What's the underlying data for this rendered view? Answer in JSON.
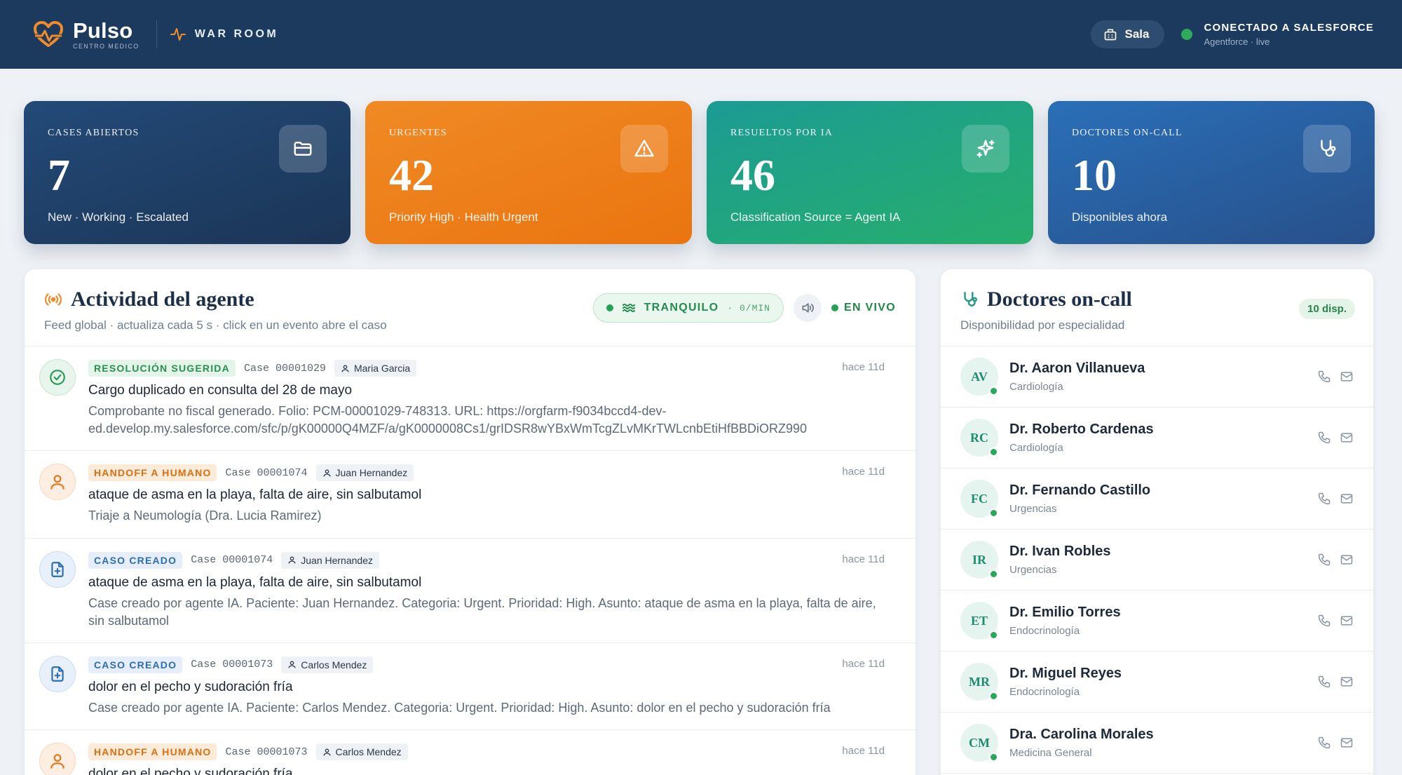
{
  "header": {
    "brand_name": "Pulso",
    "brand_sub": "CENTRO MEDICO",
    "section": "WAR ROOM",
    "sala_label": "Sala",
    "connection_title": "CONECTADO A SALESFORCE",
    "connection_sub": "Agentforce · live"
  },
  "kpis": [
    {
      "label": "CASES ABIERTOS",
      "value": "7",
      "sub": "New · Working · Escalated",
      "icon": "folder-icon"
    },
    {
      "label": "URGENTES",
      "value": "42",
      "sub": "Priority High · Health Urgent",
      "icon": "warning-icon"
    },
    {
      "label": "RESUELTOS POR IA",
      "value": "46",
      "sub": "Classification Source = Agent IA",
      "icon": "sparkles-icon"
    },
    {
      "label": "DOCTORES ON-CALL",
      "value": "10",
      "sub": "Disponibles ahora",
      "icon": "stethoscope-icon"
    }
  ],
  "activity": {
    "title": "Actividad del agente",
    "subtitle": "Feed global · actualiza cada 5 s · click en un evento abre el caso",
    "status_label": "TRANQUILO",
    "rate": "· 0/MIN",
    "live_label": "EN VIVO",
    "items": [
      {
        "tag": "RESOLUCIÓN SUGERIDA",
        "case": "Case 00001029",
        "person": "Maria Garcia",
        "time": "hace 11d",
        "title": "Cargo duplicado en consulta del 28 de mayo",
        "desc": "Comprobante no fiscal generado. Folio: PCM-00001029-748313. URL: https://orgfarm-f9034bccd4-dev-ed.develop.my.salesforce.com/sfc/p/gK00000Q4MZF/a/gK0000008Cs1/grIDSR8wYBxWmTcgZLvMKrTWLcnbEtiHfBBDiORZ990"
      },
      {
        "tag": "HANDOFF A HUMANO",
        "case": "Case 00001074",
        "person": "Juan Hernandez",
        "time": "hace 11d",
        "title": "ataque de asma en la playa, falta de aire, sin salbutamol",
        "desc": "Triaje a Neumología (Dra. Lucia Ramirez)"
      },
      {
        "tag": "CASO CREADO",
        "case": "Case 00001074",
        "person": "Juan Hernandez",
        "time": "hace 11d",
        "title": "ataque de asma en la playa, falta de aire, sin salbutamol",
        "desc": "Case creado por agente IA. Paciente: Juan Hernandez. Categoria: Urgent. Prioridad: High. Asunto: ataque de asma en la playa, falta de aire, sin salbutamol"
      },
      {
        "tag": "CASO CREADO",
        "case": "Case 00001073",
        "person": "Carlos Mendez",
        "time": "hace 11d",
        "title": "dolor en el pecho y sudoración fría",
        "desc": "Case creado por agente IA. Paciente: Carlos Mendez. Categoria: Urgent. Prioridad: High. Asunto: dolor en el pecho y sudoración fría"
      },
      {
        "tag": "HANDOFF A HUMANO",
        "case": "Case 00001073",
        "person": "Carlos Mendez",
        "time": "hace 11d",
        "title": "dolor en el pecho y sudoración fría",
        "desc": ""
      }
    ]
  },
  "doctors": {
    "title": "Doctores on-call",
    "subtitle": "Disponibilidad por especialidad",
    "count_badge": "10 disp.",
    "list": [
      {
        "initials": "AV",
        "name": "Dr. Aaron Villanueva",
        "specialty": "Cardiología"
      },
      {
        "initials": "RC",
        "name": "Dr. Roberto Cardenas",
        "specialty": "Cardiología"
      },
      {
        "initials": "FC",
        "name": "Dr. Fernando Castillo",
        "specialty": "Urgencias"
      },
      {
        "initials": "IR",
        "name": "Dr. Ivan Robles",
        "specialty": "Urgencias"
      },
      {
        "initials": "ET",
        "name": "Dr. Emilio Torres",
        "specialty": "Endocrinología"
      },
      {
        "initials": "MR",
        "name": "Dr. Miguel Reyes",
        "specialty": "Endocrinología"
      },
      {
        "initials": "CM",
        "name": "Dra. Carolina Morales",
        "specialty": "Medicina General"
      }
    ]
  },
  "colors": {
    "header_bg": "#1c3a5e",
    "accent_orange": "#f08a24",
    "accent_green": "#27ae6c",
    "accent_blue": "#2a6fb8"
  }
}
